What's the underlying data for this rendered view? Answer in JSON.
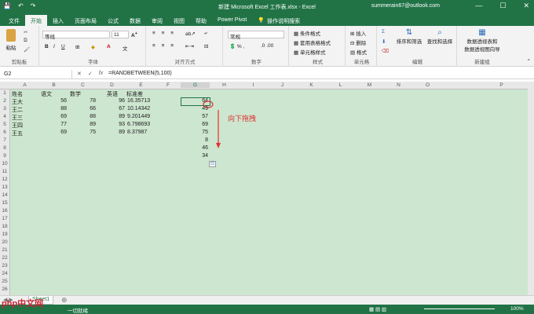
{
  "window": {
    "title": "新建 Microsoft Excel 工作表.xlsx  -  Excel",
    "user": "summerain67@outlook.com",
    "qa_save": "💾",
    "qa_undo": "↶",
    "qa_redo": "↷",
    "min": "—",
    "max": "☐",
    "close": "✕"
  },
  "tabs": [
    "文件",
    "开始",
    "插入",
    "页面布局",
    "公式",
    "数据",
    "审阅",
    "视图",
    "帮助",
    "Power Pivot"
  ],
  "tell_me": "操作说明搜索",
  "ribbon": {
    "paste": "粘贴",
    "clipboard": "剪贴板",
    "font_name": "等线",
    "font_size": "11",
    "font_group": "字体",
    "bold": "B",
    "italic": "I",
    "underline": "U",
    "align_group": "对齐方式",
    "number_format": "常规",
    "number_group": "数字",
    "cond_format": "条件格式",
    "table_format": "套用表格格式",
    "cell_style": "单元格样式",
    "style_group": "样式",
    "insert": "插入",
    "delete": "删除",
    "format": "格式",
    "cells_group": "单元格",
    "sort_filter": "排序和筛选",
    "find_select": "查找和选择",
    "edit_group": "编辑",
    "pivot_line1": "数据透视表和",
    "pivot_line2": "数据透视图向导",
    "new_group": "新建组"
  },
  "formula_bar": {
    "name_box": "G2",
    "cancel": "✕",
    "enter": "✓",
    "fx": "fx",
    "formula": "=RANDBETWEEN(5,100)"
  },
  "columns": [
    "A",
    "B",
    "C",
    "D",
    "E",
    "F",
    "G",
    "H",
    "I",
    "J",
    "K",
    "L",
    "M",
    "N",
    "O",
    "P"
  ],
  "rows": [
    "1",
    "2",
    "3",
    "4",
    "5",
    "6",
    "7",
    "8",
    "9",
    "10",
    "11",
    "12",
    "13",
    "14",
    "15",
    "16",
    "17",
    "18",
    "19",
    "20",
    "21",
    "22",
    "23",
    "24",
    "25",
    "26"
  ],
  "headers": [
    "姓名",
    "语文",
    "数学",
    "英语",
    "标准差"
  ],
  "data": [
    [
      "王大",
      "56",
      "78",
      "96",
      "16.35713"
    ],
    [
      "王二",
      "88",
      "66",
      "67",
      "10.14342"
    ],
    [
      "王三",
      "69",
      "88",
      "89",
      "9.201449"
    ],
    [
      "王四",
      "77",
      "89",
      "93",
      "6.798693"
    ],
    [
      "王五",
      "69",
      "75",
      "89",
      "8.37987"
    ]
  ],
  "g_values": [
    "64",
    "49",
    "57",
    "69",
    "75",
    "8",
    "46",
    "34"
  ],
  "annotation": "向下拖拽",
  "sheet_tab": "Sheet1",
  "status_text": "一切就绪",
  "zoom": "100%",
  "watermark": "php中文网"
}
